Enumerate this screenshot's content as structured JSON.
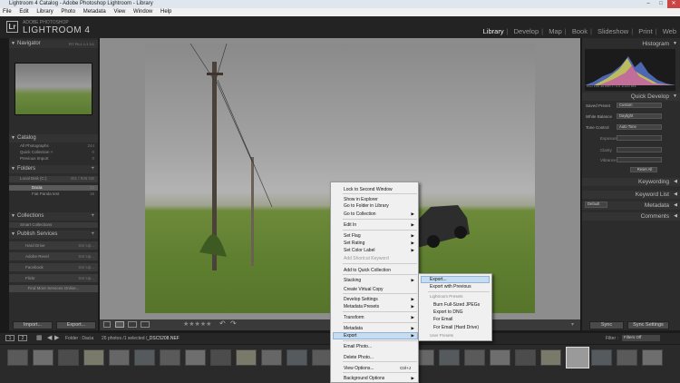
{
  "window": {
    "title": "Lightroom 4 Catalog - Adobe Photoshop Lightroom - Library",
    "minimize": "–",
    "maximize": "□",
    "close": "✕"
  },
  "menubar": [
    "File",
    "Edit",
    "Library",
    "Photo",
    "Metadata",
    "View",
    "Window",
    "Help"
  ],
  "identity": {
    "logo": "Lr",
    "brand_small": "ADOBE PHOTOSHOP",
    "brand": "LIGHTROOM 4"
  },
  "modules": [
    "Library",
    "Develop",
    "Map",
    "Book",
    "Slideshow",
    "Print",
    "Web"
  ],
  "left_panel": {
    "navigator": {
      "title": "Navigator",
      "zoom": "FIT  FILL  1:1  3:1"
    },
    "catalog": {
      "title": "Catalog",
      "rows": [
        {
          "label": "All Photographs",
          "count": "244"
        },
        {
          "label": "Quick Collection +",
          "count": "0"
        },
        {
          "label": "Previous Import",
          "count": "0"
        }
      ]
    },
    "folders": {
      "title": "Folders",
      "disk": "Local Disk (C:)",
      "disk_info": "401 / 936 GB",
      "rows": [
        {
          "label": "Dacia",
          "count": "26"
        },
        {
          "label": "Fiat Panda test",
          "count": "16"
        }
      ]
    },
    "collections": {
      "title": "Collections",
      "rows": [
        {
          "label": "Smart Collections"
        }
      ]
    },
    "publish": {
      "title": "Publish Services",
      "rows": [
        {
          "label": "Hard Drive",
          "action": "Set Up..."
        },
        {
          "label": "Adobe Revel",
          "action": "Set Up..."
        },
        {
          "label": "Facebook",
          "action": "Set Up..."
        },
        {
          "label": "Flickr",
          "action": "Set Up..."
        }
      ],
      "find_more": "Find More Services Online..."
    },
    "import_label": "Import...",
    "export_label": "Export..."
  },
  "right_panel": {
    "histogram": {
      "title": "Histogram",
      "readout": "ISO 100    35 mm    f / 4.0    1/320 sec"
    },
    "quick_develop": {
      "title": "Quick Develop",
      "saved_preset_label": "Saved Preset",
      "saved_preset_value": "Custom",
      "wb_label": "White Balance",
      "wb_value": "Daylight",
      "tone_label": "Tone Control",
      "tone_value": "Auto Tone",
      "exposure": "Exposure",
      "clarity": "Clarity",
      "vibrance": "Vibrance",
      "reset": "Reset All"
    },
    "keywording": "Keywording",
    "keyword_list": "Keyword List",
    "default_label": "Default",
    "metadata": "Metadata",
    "comments": "Comments",
    "sync_label": "Sync",
    "sync_settings_label": "Sync Settings"
  },
  "filmstrip": {
    "page_numbers": [
      "1",
      "2"
    ],
    "folder": "Folder : Dacia",
    "status": "26 photos /1 selected /",
    "filename": "_DSC5208.NEF",
    "filter_label": "Filter :",
    "filter_value": "Filters Off"
  },
  "context_menu": {
    "items": [
      {
        "label": "Lock to Second Window",
        "sub": false,
        "disabled": false,
        "shortcut": ""
      },
      {
        "label": "Show in Explorer",
        "sub": false,
        "disabled": false,
        "shortcut": ""
      },
      {
        "label": "Go to Folder in Library",
        "sub": false,
        "disabled": false,
        "shortcut": ""
      },
      {
        "label": "Go to Collection",
        "sub": true,
        "disabled": false,
        "shortcut": ""
      },
      {
        "label": "Edit In",
        "sub": true,
        "disabled": false,
        "shortcut": ""
      },
      {
        "label": "Set Flag",
        "sub": true,
        "disabled": false,
        "shortcut": ""
      },
      {
        "label": "Set Rating",
        "sub": true,
        "disabled": false,
        "shortcut": ""
      },
      {
        "label": "Set Color Label",
        "sub": true,
        "disabled": false,
        "shortcut": ""
      },
      {
        "label": "Add Shortcut Keyword",
        "sub": false,
        "disabled": true,
        "shortcut": ""
      },
      {
        "label": "Add to Quick Collection",
        "sub": false,
        "disabled": false,
        "shortcut": ""
      },
      {
        "label": "Stacking",
        "sub": true,
        "disabled": false,
        "shortcut": ""
      },
      {
        "label": "Create Virtual Copy",
        "sub": false,
        "disabled": false,
        "shortcut": ""
      },
      {
        "label": "Develop Settings",
        "sub": true,
        "disabled": false,
        "shortcut": ""
      },
      {
        "label": "Metadata Presets",
        "sub": true,
        "disabled": false,
        "shortcut": ""
      },
      {
        "label": "Transform",
        "sub": true,
        "disabled": false,
        "shortcut": ""
      },
      {
        "label": "Metadata",
        "sub": true,
        "disabled": false,
        "shortcut": ""
      },
      {
        "label": "Export",
        "sub": true,
        "disabled": false,
        "shortcut": ""
      },
      {
        "label": "Email Photo...",
        "sub": false,
        "disabled": false,
        "shortcut": ""
      },
      {
        "label": "Delete Photo...",
        "sub": false,
        "disabled": false,
        "shortcut": ""
      },
      {
        "label": "View Options...",
        "sub": false,
        "disabled": false,
        "shortcut": "Ctrl+J"
      },
      {
        "label": "Background Options",
        "sub": true,
        "disabled": false,
        "shortcut": ""
      }
    ]
  },
  "submenu": {
    "items": [
      {
        "label": "Export...",
        "disabled": false
      },
      {
        "label": "Export with Previous",
        "disabled": false
      },
      {
        "label": "Lightroom Presets",
        "disabled": true
      },
      {
        "label": "Burn Full-Sized JPEGs",
        "disabled": false
      },
      {
        "label": "Export to DNG",
        "disabled": false
      },
      {
        "label": "For Email",
        "disabled": false
      },
      {
        "label": "For Email (Hard Drive)",
        "disabled": false
      },
      {
        "label": "User Presets",
        "disabled": true
      }
    ]
  }
}
